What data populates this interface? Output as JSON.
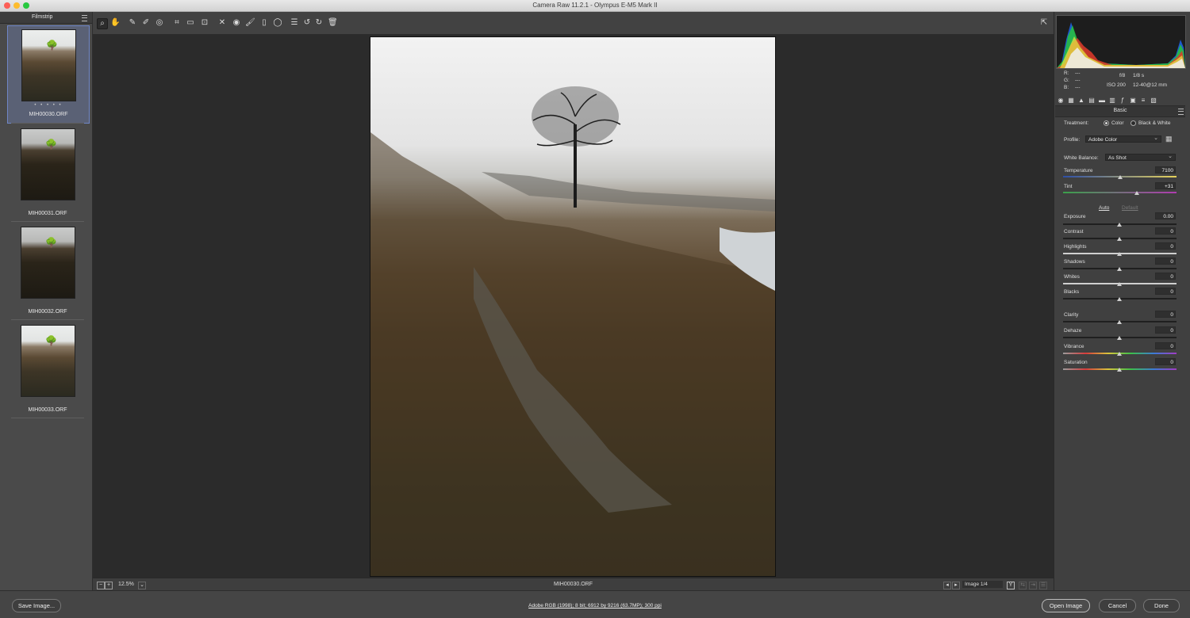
{
  "window": {
    "title": "Camera Raw 11.2.1  -  Olympus E-M5 Mark II"
  },
  "filmstrip": {
    "title": "Filmstrip",
    "items": [
      {
        "name": "MIH00030.ORF",
        "rating": "• • • • •",
        "selected": true
      },
      {
        "name": "MIH00031.ORF"
      },
      {
        "name": "MIH00032.ORF"
      },
      {
        "name": "MIH00033.ORF"
      }
    ]
  },
  "toolbar": {
    "tools": [
      "zoom-tool",
      "hand-tool",
      "white-balance-tool",
      "color-sampler-tool",
      "targeted-adjustment-tool",
      "crop-tool",
      "straighten-tool",
      "transform-tool",
      "spot-removal-tool",
      "red-eye-tool",
      "adjustment-brush",
      "graduated-filter",
      "radial-filter",
      "preferences",
      "rotate-left",
      "rotate-right",
      "trash"
    ]
  },
  "statusbar": {
    "zoom": "12.5%",
    "filename": "MIH00030.ORF",
    "image_counter": "Image 1/4"
  },
  "info": {
    "r_label": "R:",
    "g_label": "G:",
    "b_label": "B:",
    "r": "---",
    "g": "---",
    "b": "---",
    "aperture": "f/8",
    "shutter": "1/8 s",
    "iso": "ISO 200",
    "lens": "12-40@12 mm"
  },
  "basic": {
    "header": "Basic",
    "treatment_label": "Treatment:",
    "treatment_color": "Color",
    "treatment_bw": "Black & White",
    "profile_label": "Profile:",
    "profile_value": "Adobe Color",
    "wb_label": "White Balance:",
    "wb_value": "As Shot",
    "auto": "Auto",
    "default": "Default",
    "sliders": [
      {
        "label": "Temperature",
        "value": "7100"
      },
      {
        "label": "Tint",
        "value": "+31"
      },
      {
        "label": "Exposure",
        "value": "0.00"
      },
      {
        "label": "Contrast",
        "value": "0"
      },
      {
        "label": "Highlights",
        "value": "0"
      },
      {
        "label": "Shadows",
        "value": "0"
      },
      {
        "label": "Whites",
        "value": "0"
      },
      {
        "label": "Blacks",
        "value": "0"
      },
      {
        "label": "Clarity",
        "value": "0"
      },
      {
        "label": "Dehaze",
        "value": "0"
      },
      {
        "label": "Vibrance",
        "value": "0"
      },
      {
        "label": "Saturation",
        "value": "0"
      }
    ]
  },
  "footer": {
    "save": "Save Image...",
    "file_info": "Adobe RGB (1998); 8 bit; 6912 by 9216 (63.7MP); 300 ppi",
    "open": "Open Image",
    "cancel": "Cancel",
    "done": "Done"
  },
  "colors": {
    "accent": "#6f86c6",
    "panel": "#404040",
    "canvas": "#2b2b2b"
  }
}
